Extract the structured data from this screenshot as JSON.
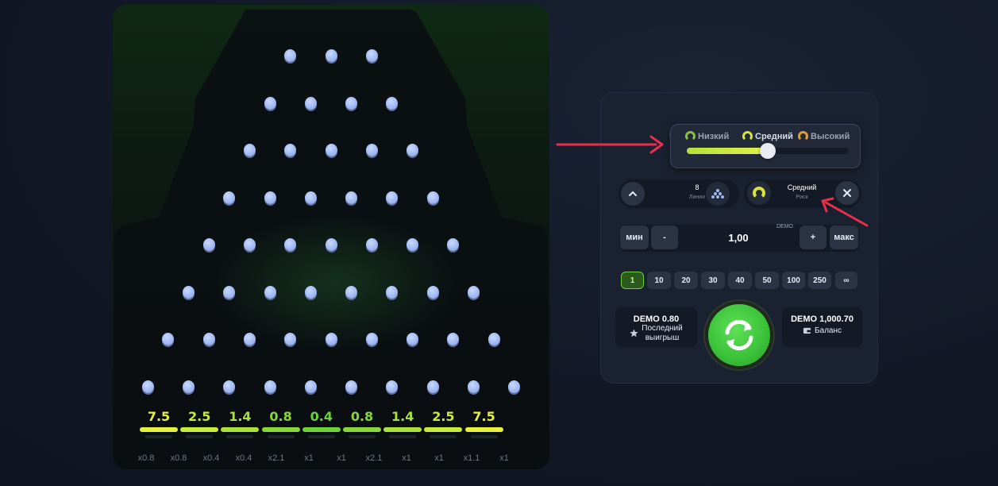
{
  "board": {
    "peg_rows": [
      3,
      4,
      5,
      6,
      7,
      8,
      9,
      10
    ],
    "multipliers": [
      {
        "label": "7.5",
        "color": "#e6f040"
      },
      {
        "label": "2.5",
        "color": "#c9ea3e"
      },
      {
        "label": "1.4",
        "color": "#a9e23c"
      },
      {
        "label": "0.8",
        "color": "#86d83a"
      },
      {
        "label": "0.4",
        "color": "#6cd33a"
      },
      {
        "label": "0.8",
        "color": "#86d83a"
      },
      {
        "label": "1.4",
        "color": "#a9e23c"
      },
      {
        "label": "2.5",
        "color": "#c9ea3e"
      },
      {
        "label": "7.5",
        "color": "#e6f040"
      }
    ],
    "history": [
      "x0.8",
      "x0.8",
      "x0.4",
      "x0.4",
      "x2.1",
      "x1",
      "x1",
      "x2.1",
      "x1",
      "x1",
      "x1.1",
      "x1"
    ]
  },
  "risk_selector": {
    "options": [
      {
        "label": "Низкий",
        "icon": "gauge-low-icon"
      },
      {
        "label": "Средний",
        "icon": "gauge-medium-icon"
      },
      {
        "label": "Высокий",
        "icon": "gauge-high-icon"
      }
    ],
    "slider_value": 0.5
  },
  "lines": {
    "value": "8",
    "label": "Линии"
  },
  "risk": {
    "value": "Средний",
    "label": "Риск"
  },
  "bet": {
    "min_label": "мин",
    "minus_label": "-",
    "value": "1,00",
    "currency": "DEMO",
    "plus_label": "+",
    "max_label": "макс"
  },
  "chips": [
    "1",
    "10",
    "20",
    "30",
    "40",
    "50",
    "100",
    "250",
    "∞"
  ],
  "active_chip": 0,
  "last_win": {
    "amount": "DEMO 0.80",
    "label_line1": "Последний",
    "label_line2": "выигрыш"
  },
  "balance": {
    "amount": "DEMO 1,000.70",
    "label": "Баланс"
  },
  "colors": {
    "accent": "#6cd33a",
    "arrow": "#e8304c",
    "peg": "#a8c0f5",
    "play": "#3cc43a"
  }
}
